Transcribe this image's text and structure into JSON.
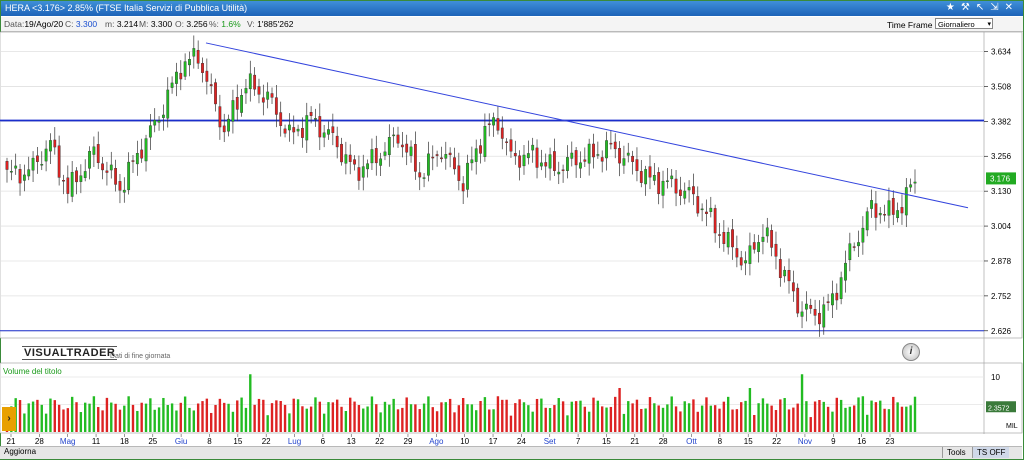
{
  "window": {
    "title": "HERA <3.176> 2.85%  (FTSE Italia Servizi di Pubblica Utilità)"
  },
  "window_icons": [
    "star-icon",
    "hammer-icon",
    "arrow-icon",
    "resize-icon",
    "close-icon"
  ],
  "infobar": {
    "data_label": "Data:",
    "data_value": "19/Ago/20",
    "c_label": "C:",
    "c_value": "3.300",
    "m_label": "m:",
    "m_value": "3.214",
    "M_label": "M:",
    "M_value": "3.300",
    "o_label": "O:",
    "o_value": "3.256",
    "pct_label": "%:",
    "pct_value": "1.6%",
    "v_label": "V:",
    "v_value": "1'885'262"
  },
  "timeframe": {
    "label": "Time Frame",
    "selected": "Giornaliero"
  },
  "logo": {
    "text": "VISUALTRADER",
    "sub": "Dati di fine giornata"
  },
  "volume_label": "Volume del titolo",
  "bottom": {
    "aggiorna": "Aggiorna",
    "tools": "Tools",
    "ts_off": "TS OFF"
  },
  "colors": {
    "up": "#22bb22",
    "down": "#dd2222",
    "trend": "#3344dd",
    "hline": "#1a2ecc",
    "price_tag": "#22aa22"
  },
  "chart_data": {
    "type": "candlestick",
    "price_ticks": [
      "3.634",
      "3.508",
      "3.382",
      "3.256",
      "3.130",
      "3.004",
      "2.878",
      "2.752",
      "2.626"
    ],
    "last_price": "3.176",
    "volume_ticks": [
      "10",
      "5"
    ],
    "volume_tag": "2.3572",
    "volume_unit": "MIL",
    "horizontal_levels": [
      3.385,
      2.626
    ],
    "trendline": {
      "from": [
        0.0,
        3.665
      ],
      "to": [
        1.0,
        3.07
      ]
    },
    "x_labels": [
      {
        "t": "21",
        "c": "k"
      },
      {
        "t": "28",
        "c": "k"
      },
      {
        "t": "Mag",
        "c": "b"
      },
      {
        "t": "11",
        "c": "k"
      },
      {
        "t": "18",
        "c": "k"
      },
      {
        "t": "25",
        "c": "k"
      },
      {
        "t": "Giu",
        "c": "b"
      },
      {
        "t": "8",
        "c": "k"
      },
      {
        "t": "15",
        "c": "k"
      },
      {
        "t": "22",
        "c": "k"
      },
      {
        "t": "Lug",
        "c": "b"
      },
      {
        "t": "6",
        "c": "k"
      },
      {
        "t": "13",
        "c": "k"
      },
      {
        "t": "22",
        "c": "k"
      },
      {
        "t": "29",
        "c": "k"
      },
      {
        "t": "Ago",
        "c": "b"
      },
      {
        "t": "10",
        "c": "k"
      },
      {
        "t": "17",
        "c": "k"
      },
      {
        "t": "24",
        "c": "k"
      },
      {
        "t": "Set",
        "c": "b"
      },
      {
        "t": "7",
        "c": "k"
      },
      {
        "t": "15",
        "c": "k"
      },
      {
        "t": "21",
        "c": "k"
      },
      {
        "t": "28",
        "c": "k"
      },
      {
        "t": "Ott",
        "c": "b"
      },
      {
        "t": "8",
        "c": "k"
      },
      {
        "t": "15",
        "c": "k"
      },
      {
        "t": "22",
        "c": "k"
      },
      {
        "t": "Nov",
        "c": "b"
      },
      {
        "t": "9",
        "c": "k"
      },
      {
        "t": "16",
        "c": "k"
      },
      {
        "t": "23",
        "c": "k"
      }
    ],
    "anchors": [
      [
        0,
        3.19
      ],
      [
        5,
        3.2
      ],
      [
        10,
        3.3
      ],
      [
        14,
        3.13
      ],
      [
        20,
        3.27
      ],
      [
        26,
        3.14
      ],
      [
        30,
        3.26
      ],
      [
        35,
        3.4
      ],
      [
        40,
        3.58
      ],
      [
        44,
        3.62
      ],
      [
        47,
        3.48
      ],
      [
        50,
        3.35
      ],
      [
        55,
        3.52
      ],
      [
        60,
        3.47
      ],
      [
        65,
        3.33
      ],
      [
        70,
        3.39
      ],
      [
        75,
        3.32
      ],
      [
        80,
        3.2
      ],
      [
        85,
        3.25
      ],
      [
        90,
        3.33
      ],
      [
        95,
        3.19
      ],
      [
        100,
        3.28
      ],
      [
        105,
        3.16
      ],
      [
        110,
        3.35
      ],
      [
        113,
        3.38
      ],
      [
        116,
        3.25
      ],
      [
        121,
        3.26
      ],
      [
        126,
        3.21
      ],
      [
        130,
        3.24
      ],
      [
        135,
        3.26
      ],
      [
        139,
        3.29
      ],
      [
        143,
        3.24
      ],
      [
        148,
        3.17
      ],
      [
        152,
        3.16
      ],
      [
        157,
        3.12
      ],
      [
        160,
        3.07
      ],
      [
        165,
        2.96
      ],
      [
        170,
        2.87
      ],
      [
        174,
        2.99
      ],
      [
        178,
        2.86
      ],
      [
        182,
        2.72
      ],
      [
        186,
        2.68
      ],
      [
        190,
        2.73
      ],
      [
        193,
        2.87
      ],
      [
        196,
        2.97
      ],
      [
        199,
        3.07
      ],
      [
        203,
        3.05
      ],
      [
        206,
        3.08
      ],
      [
        209,
        3.17
      ]
    ]
  }
}
